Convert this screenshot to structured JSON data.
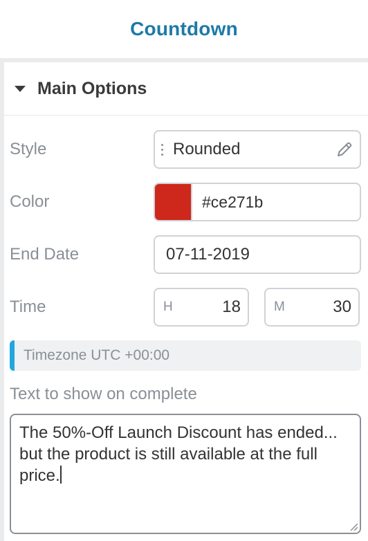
{
  "header": {
    "title": "Countdown"
  },
  "section": {
    "title": "Main Options",
    "expanded": true,
    "caret_icon": "caret-down-icon"
  },
  "fields": {
    "style": {
      "label": "Style",
      "value": "Rounded",
      "edit_icon": "pencil-icon"
    },
    "color": {
      "label": "Color",
      "value": "#ce271b",
      "swatch": "#ce271b"
    },
    "end_date": {
      "label": "End Date",
      "value": "07-11-2019"
    },
    "time": {
      "label": "Time",
      "hours_unit": "H",
      "hours": "18",
      "minutes_unit": "M",
      "minutes": "30"
    }
  },
  "timezone_notice": {
    "text": "Timezone UTC +00:00",
    "accent": "#23a6e0"
  },
  "complete_text": {
    "label": "Text to show on complete",
    "value": "The 50%-Off Launch Discount has ended... but the product is still available at the full price."
  },
  "colors": {
    "title": "#1d7aa6",
    "label": "#8a8f96"
  }
}
